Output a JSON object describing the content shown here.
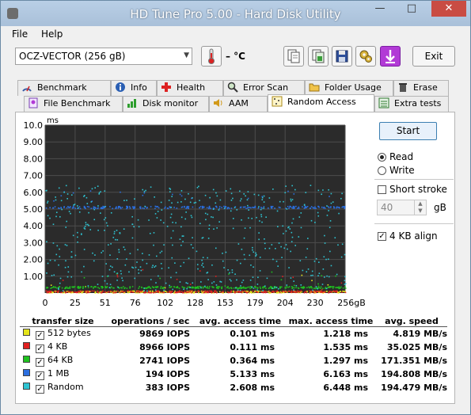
{
  "window": {
    "title": "HD Tune Pro 5.00 - Hard Disk Utility",
    "minimize": "—",
    "maximize": "□",
    "close": "✕"
  },
  "menu": {
    "file": "File",
    "help": "Help"
  },
  "toolbar": {
    "drive": "OCZ-VECTOR (256 gB)",
    "temperature": "– °C",
    "exit_label": "Exit"
  },
  "tabs_row1": [
    "Benchmark",
    "Info",
    "Health",
    "Error Scan",
    "Folder Usage",
    "Erase"
  ],
  "tabs_row2": [
    "File Benchmark",
    "Disk monitor",
    "AAM",
    "Random Access",
    "Extra tests"
  ],
  "active_tab": "Random Access",
  "controls": {
    "start_label": "Start",
    "read_label": "Read",
    "write_label": "Write",
    "read_selected": true,
    "short_stroke_label": "Short stroke",
    "short_stroke_checked": false,
    "short_stroke_value": "40",
    "short_stroke_unit": "gB",
    "align_label": "4 KB align",
    "align_checked": true
  },
  "chart_data": {
    "type": "scatter",
    "ylabel": "ms",
    "ylim": [
      0,
      10
    ],
    "xlim": [
      0,
      256
    ],
    "y_ticks": [
      "10.0",
      "9.00",
      "8.00",
      "7.00",
      "6.00",
      "5.00",
      "4.00",
      "3.00",
      "2.00",
      "1.00"
    ],
    "x_ticks": [
      "0",
      "25",
      "51",
      "76",
      "102",
      "128",
      "153",
      "179",
      "204",
      "230",
      "256gB"
    ],
    "grid": true,
    "series": [
      {
        "name": "512 bytes",
        "color": "#e5e51a",
        "typical_ms": 0.101,
        "max_ms": 1.218
      },
      {
        "name": "4 KB",
        "color": "#e12020",
        "typical_ms": 0.111,
        "max_ms": 1.535
      },
      {
        "name": "64 KB",
        "color": "#1fc21f",
        "typical_ms": 0.364,
        "max_ms": 1.297
      },
      {
        "name": "1 MB",
        "color": "#2b6fe0",
        "typical_ms": 5.133,
        "max_ms": 6.163
      },
      {
        "name": "Random",
        "color": "#2ec4d2",
        "typical_ms": 2.608,
        "max_ms": 6.448
      }
    ]
  },
  "results": {
    "headers": [
      "transfer size",
      "operations / sec",
      "avg. access time",
      "max. access time",
      "avg. speed"
    ],
    "rows": [
      {
        "color": "#e5e51a",
        "size": "512 bytes",
        "ops": "9869 IOPS",
        "avg": "0.101 ms",
        "max": "1.218 ms",
        "speed": "4.819 MB/s"
      },
      {
        "color": "#e12020",
        "size": "4 KB",
        "ops": "8966 IOPS",
        "avg": "0.111 ms",
        "max": "1.535 ms",
        "speed": "35.025 MB/s"
      },
      {
        "color": "#1fc21f",
        "size": "64 KB",
        "ops": "2741 IOPS",
        "avg": "0.364 ms",
        "max": "1.297 ms",
        "speed": "171.351 MB/s"
      },
      {
        "color": "#2b6fe0",
        "size": "1 MB",
        "ops": "194 IOPS",
        "avg": "5.133 ms",
        "max": "6.163 ms",
        "speed": "194.808 MB/s"
      },
      {
        "color": "#2ec4d2",
        "size": "Random",
        "ops": "383 IOPS",
        "avg": "2.608 ms",
        "max": "6.448 ms",
        "speed": "194.479 MB/s"
      }
    ]
  }
}
